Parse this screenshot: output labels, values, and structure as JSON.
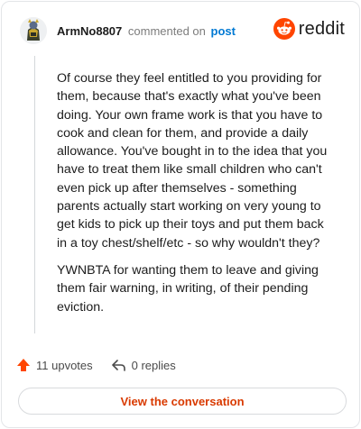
{
  "header": {
    "username": "ArmNo8807",
    "action_text": "commented on",
    "post_link": "post",
    "brand": "reddit"
  },
  "comment": {
    "paragraphs": [
      "Of course they feel entitled to you providing for them, because that's exactly what you've been doing. Your own frame work is that you have to cook and clean for them, and provide a daily allowance. You've bought in to the idea that you have to treat them like small children who can't even pick up after themselves - something parents actually start working on very young to get kids to pick up their toys and put them back in a toy chest/shelf/etc - so why wouldn't they?",
      "YWNBTA for wanting them to leave and giving them fair warning, in writing, of their pending eviction."
    ]
  },
  "actions": {
    "upvotes": "11 upvotes",
    "replies": "0 replies"
  },
  "footer": {
    "view_label": "View the conversation"
  },
  "colors": {
    "upvote": "#ff4500",
    "link": "#0079d3",
    "view_button_text": "#d93a00",
    "brand_orange": "#ff4500"
  },
  "icons": {
    "avatar": "snoo-avatar",
    "brand": "reddit-logo-icon",
    "upvote": "upvote-arrow-icon",
    "reply": "reply-arrow-icon"
  }
}
